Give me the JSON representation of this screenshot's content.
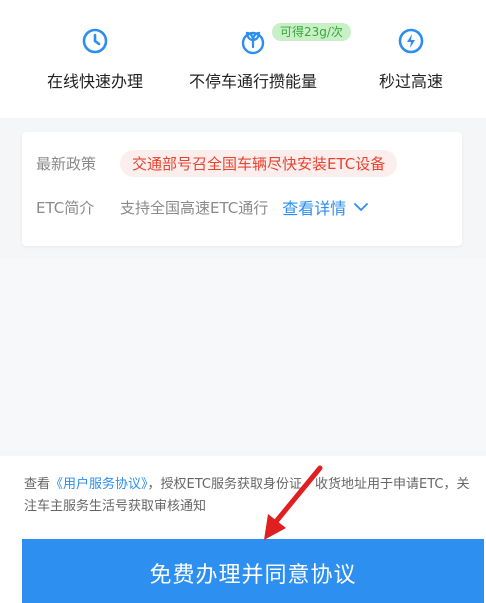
{
  "features": [
    {
      "label": "在线快速办理",
      "icon": "clock-icon"
    },
    {
      "label": "不停车通行攒能量",
      "icon": "sprout-icon"
    },
    {
      "label": "秒过高速",
      "icon": "lightning-icon"
    }
  ],
  "badge": {
    "text": "可得23g/次"
  },
  "card": {
    "policy_key": "最新政策",
    "policy_text": "交通部号召全国车辆尽快安装ETC设备",
    "intro_key": "ETC简介",
    "intro_text": "支持全国高速ETC通行",
    "detail_link": "查看详情"
  },
  "agreement": {
    "prefix": "查看",
    "link": "《用户服务协议》",
    "suffix": "，授权ETC服务获取身份证、收货地址用于申请ETC，关注车主服务生活号获取审核通知"
  },
  "submit_button": {
    "label": "免费办理并同意协议"
  },
  "colors": {
    "accent": "#2d8ff0",
    "policy_red": "#e8432f",
    "badge_green": "#3aa53a",
    "arrow_red": "#e02020"
  }
}
